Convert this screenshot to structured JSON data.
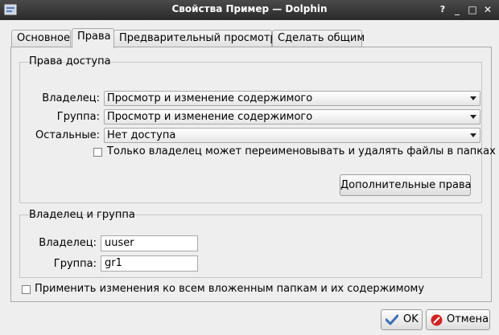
{
  "window": {
    "title": "Свойства Пример — Dolphin",
    "controls": {
      "help": "?",
      "min": "_",
      "max": "□",
      "close": "✕"
    }
  },
  "tabs": [
    {
      "label": "Основное",
      "active": false
    },
    {
      "label": "Права",
      "active": true
    },
    {
      "label": "Предварительный просмотр",
      "active": false
    },
    {
      "label": "Сделать общим",
      "active": false
    }
  ],
  "access": {
    "title": "Права доступа",
    "owner_label": "Владелец:",
    "owner_value": "Просмотр и изменение содержимого",
    "group_label": "Группа:",
    "group_value": "Просмотр и изменение содержимого",
    "others_label": "Остальные:",
    "others_value": "Нет доступа",
    "only_owner_checkbox": "Только владелец может переименовывать и удалять файлы в папках",
    "only_owner_checked": false,
    "advanced_button": "Дополнительные права"
  },
  "ownership": {
    "title": "Владелец и группа",
    "owner_label": "Владелец:",
    "owner_value": "uuser",
    "group_label": "Группа:",
    "group_value": "gr1"
  },
  "apply_recursive": {
    "label": "Применить изменения ко всем вложенным папкам и их содержимому",
    "checked": false
  },
  "buttons": {
    "ok": "OK",
    "cancel": "Отмена"
  },
  "colors": {
    "titlebar": "#333333",
    "ok_icon": "#3b6fb6",
    "cancel_icon": "#d22222"
  },
  "icons": {
    "app": "dolphin-icon",
    "ok": "checkmark-icon",
    "cancel": "cancel-icon"
  }
}
